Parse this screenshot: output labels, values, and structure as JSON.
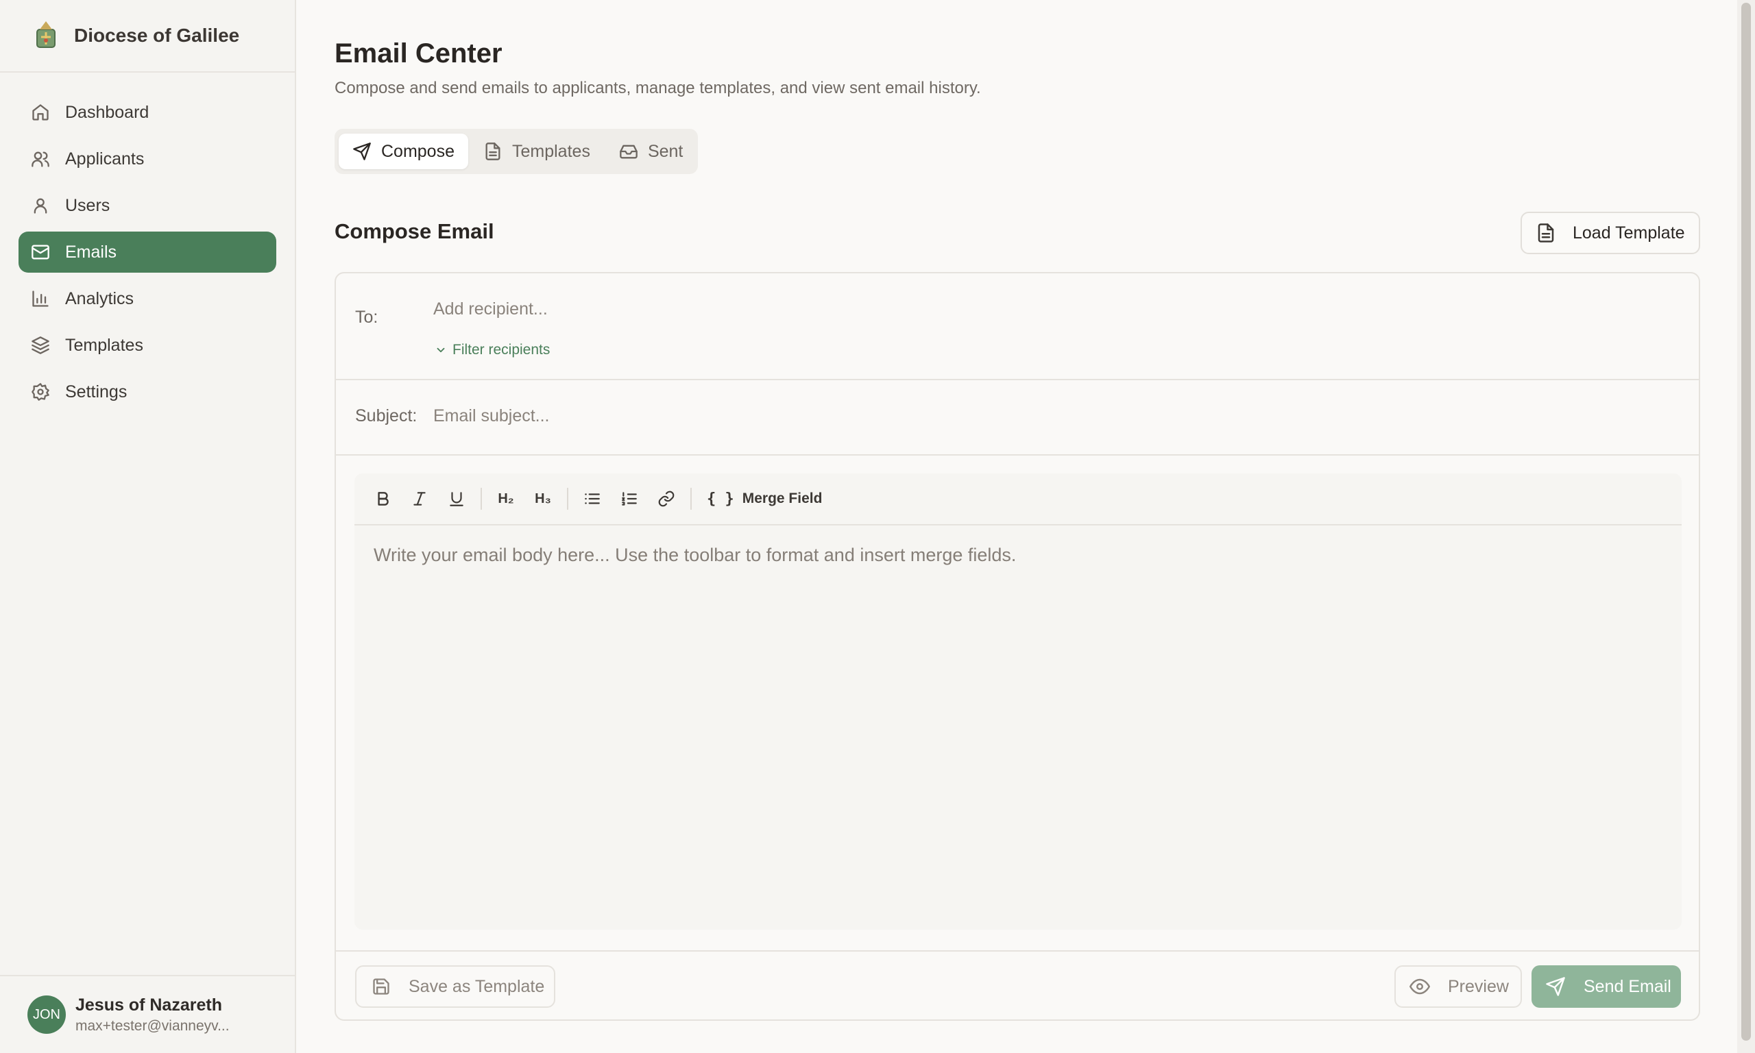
{
  "brand": {
    "name": "Diocese of Galilee"
  },
  "sidebar": {
    "items": [
      {
        "label": "Dashboard",
        "icon": "home-icon"
      },
      {
        "label": "Applicants",
        "icon": "users-icon"
      },
      {
        "label": "Users",
        "icon": "user-icon"
      },
      {
        "label": "Emails",
        "icon": "mail-icon",
        "active": true
      },
      {
        "label": "Analytics",
        "icon": "bar-chart-icon"
      },
      {
        "label": "Templates",
        "icon": "layers-icon"
      },
      {
        "label": "Settings",
        "icon": "gear-icon"
      }
    ]
  },
  "user": {
    "initials": "JON",
    "name": "Jesus of Nazareth",
    "email": "max+tester@vianneyv..."
  },
  "header": {
    "title": "Email Center",
    "subtitle": "Compose and send emails to applicants, manage templates, and view sent email history."
  },
  "tabs": [
    {
      "label": "Compose",
      "icon": "send-icon",
      "active": true
    },
    {
      "label": "Templates",
      "icon": "file-icon"
    },
    {
      "label": "Sent",
      "icon": "inbox-icon"
    }
  ],
  "compose": {
    "title": "Compose Email",
    "load_template_label": "Load Template",
    "to_label": "To:",
    "to_placeholder": "Add recipient...",
    "filter_label": "Filter recipients",
    "subject_label": "Subject:",
    "subject_placeholder": "Email subject...",
    "toolbar": {
      "h2": "H₂",
      "h3": "H₃",
      "merge_braces": "{ }",
      "merge_label": "Merge Field"
    },
    "body_placeholder": "Write your email body here... Use the toolbar to format and insert merge fields.",
    "save_template_label": "Save as Template",
    "preview_label": "Preview",
    "send_label": "Send Email"
  },
  "colors": {
    "accent": "#4a7f5a",
    "send_disabled": "#8fb59a",
    "background": "#faf9f7"
  }
}
